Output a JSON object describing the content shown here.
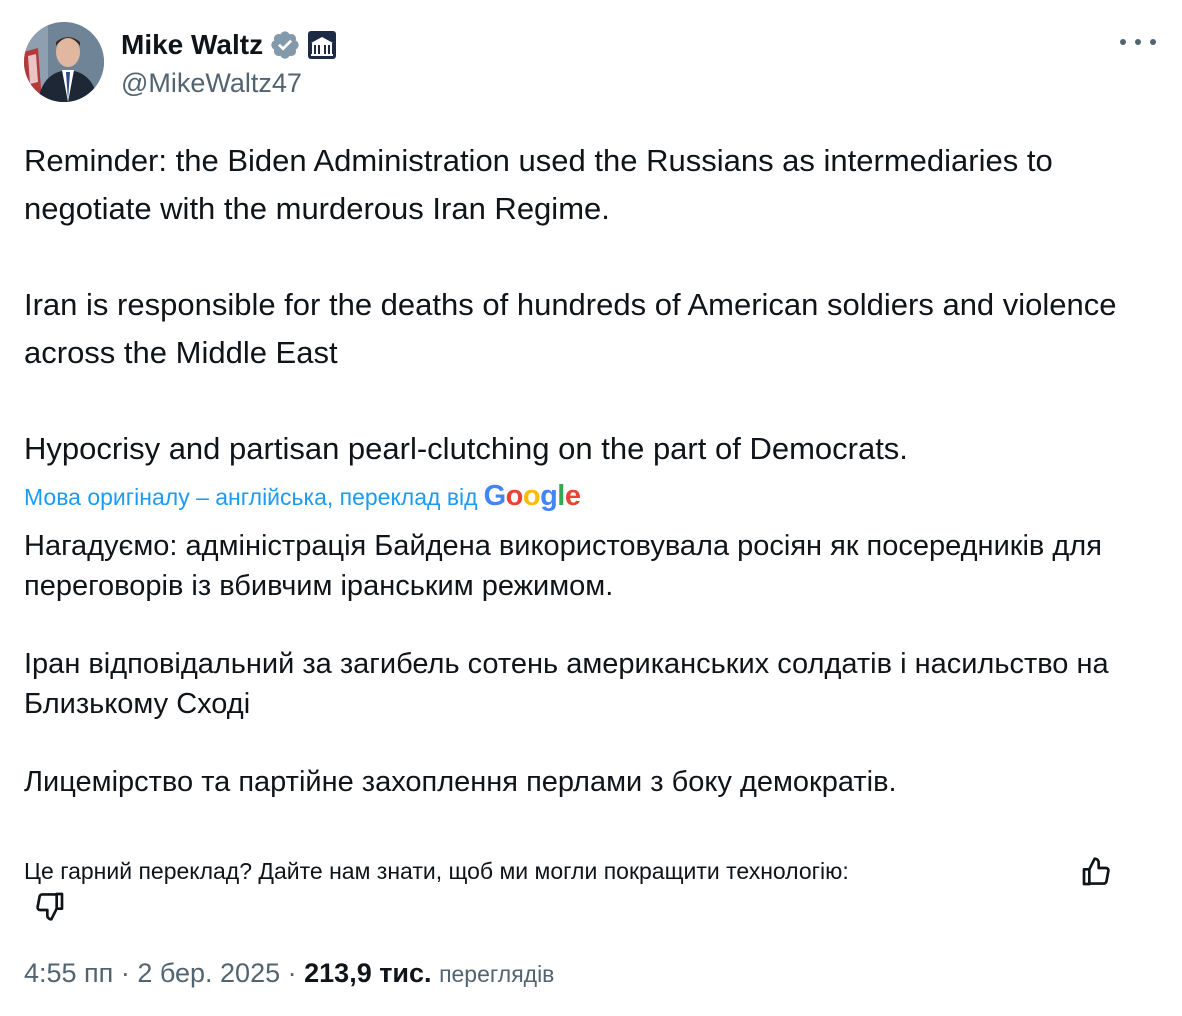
{
  "author": {
    "display_name": "Mike Waltz",
    "handle": "@MikeWaltz47",
    "verified": true,
    "affiliation_badge": "white-house-icon"
  },
  "tweet": {
    "paragraphs": [
      "Reminder: the Biden Administration used the Russians as intermediaries to negotiate with the murderous Iran Regime.",
      "Iran is responsible for the deaths of hundreds of American soldiers and violence across the Middle East",
      "Hypocrisy and partisan pearl-clutching on the part of Democrats."
    ]
  },
  "translation": {
    "note": "Мова оригіналу – англійська, переклад від",
    "provider": "Google",
    "paragraphs": [
      "Нагадуємо: адміністрація Байдена використовувала росіян як посередників для переговорів із вбивчим іранським режимом.",
      "Іран відповідальний за загибель сотень американських солдатів і насильство на Близькому Сході",
      "Лицемірство та партійне захоплення перлами з боку демократів."
    ],
    "feedback_prompt": "Це гарний переклад? Дайте нам знати, щоб ми могли покращити технологію:"
  },
  "meta": {
    "time": "4:55 пп",
    "separator": "·",
    "date": "2 бер. 2025",
    "views_count": "213,9 тис.",
    "views_label": "переглядів"
  },
  "colors": {
    "text": "#0f1419",
    "secondary": "#536471",
    "link": "#1d9bf0",
    "verified": "#829aab"
  },
  "icons": {
    "more": "more-horizontal-icon",
    "verified": "verified-badge-icon",
    "thumbs_up": "thumbs-up-icon",
    "thumbs_down": "thumbs-down-icon"
  }
}
